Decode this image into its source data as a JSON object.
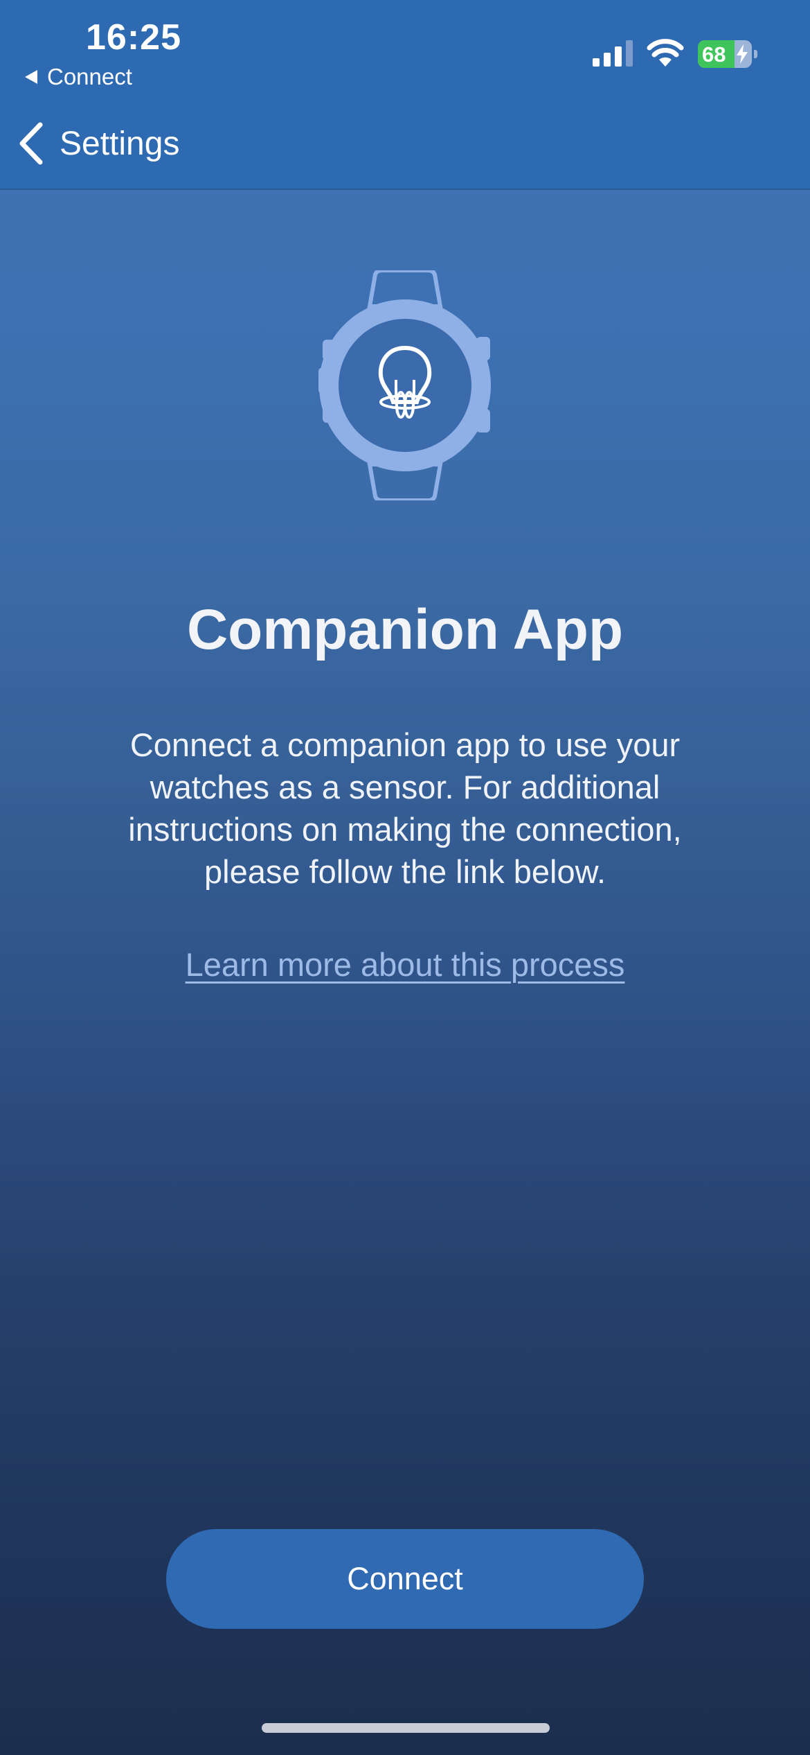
{
  "status_bar": {
    "time": "16:25",
    "back_app": "Connect",
    "battery_level": "68",
    "battery_fraction": 0.68,
    "charging": true,
    "signal_bars_active": 3,
    "signal_bars_total": 4
  },
  "nav": {
    "back_label": "Settings"
  },
  "main": {
    "title": "Companion App",
    "description": "Connect a companion app to use your watches as a sensor. For additional instructions on making the connection, please follow the link below.",
    "link_text": "Learn more about this process",
    "connect_label": "Connect"
  },
  "colors": {
    "header_bg": "#2d6ab2",
    "button_bg": "#2f6ab2",
    "link": "#9dbbe6",
    "watch_illustration": "#8fb0e6",
    "battery_green": "#3ec45a"
  },
  "icons": {
    "watch": "watch-lightbulb-icon",
    "back": "chevron-left-icon",
    "signal": "cellular-signal-icon",
    "wifi": "wifi-icon",
    "battery": "battery-charging-icon"
  }
}
